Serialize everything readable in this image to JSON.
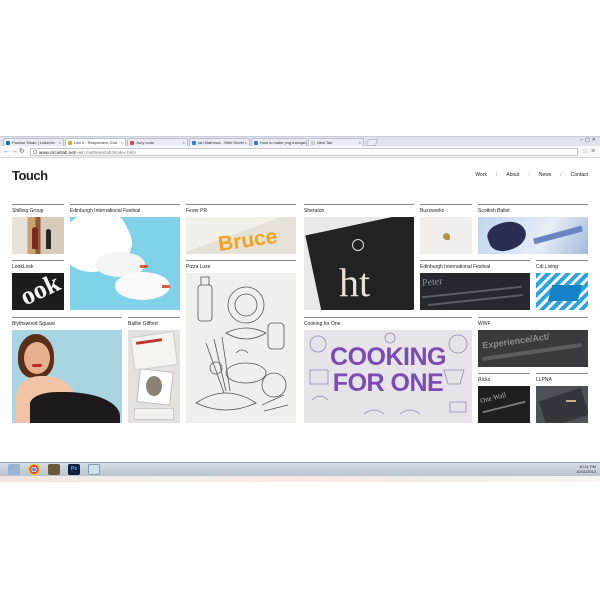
{
  "browser": {
    "tabs": [
      {
        "label": "Pauline Swan | LinkedIn",
        "active": false,
        "color": "#1a6fb0"
      },
      {
        "label": "Lab 3 - Responsive Grid",
        "active": true,
        "color": "#e2a230"
      },
      {
        "label": "Joey code",
        "active": false,
        "color": "#d44"
      },
      {
        "label": "Ian Mathews - Web Devel",
        "active": false,
        "color": "#3a7bd5"
      },
      {
        "label": "How to make png transpa",
        "active": false,
        "color": "#3a7bd5"
      },
      {
        "label": "New Tab",
        "active": false,
        "color": "#ccc"
      }
    ],
    "url_prefix": "www.circuitlab.net",
    "url_rest": "/~ian.mathews/lab3/index.html"
  },
  "site": {
    "logo": "Touch",
    "nav": [
      "Work",
      "About",
      "News",
      "Contact"
    ]
  },
  "grid": {
    "shilling": "Shilling Group",
    "edinburgh1": "Edinburgh International Festival",
    "fever": "Fever PR",
    "sheraton": "Sheraton",
    "buzzworks": "Buzzworks",
    "scottish": "Scottish Ballet",
    "looklook": "LookLook",
    "pizza": "Pizza Luxe",
    "edinburgh2": "Edinburgh International Festival",
    "cdliving": "Cdi Living",
    "blythswood": "Blythswood Square",
    "baillie": "Baillie Gifford",
    "cooking": "Cooking for One",
    "wwf": "WWF",
    "ricks": "Ricks",
    "llpna": "LLPNA"
  },
  "art": {
    "bruce": "Bruce",
    "cooking_line1": "COOKING",
    "cooking_line2": "FOR ONE",
    "looklook_glyph": "ook",
    "sheraton_text": "ht",
    "edinburgh_text": "Peter",
    "wwf_text": "Experience/Act/",
    "ricks_text": "One Wall"
  },
  "taskbar": {
    "time": "10:11 PM",
    "date": "10/11/2013"
  },
  "colors": {
    "cooking_purple": "#7a4bb5",
    "bruce_orange": "#f2a420",
    "sky_blue": "#7fd2e8"
  }
}
